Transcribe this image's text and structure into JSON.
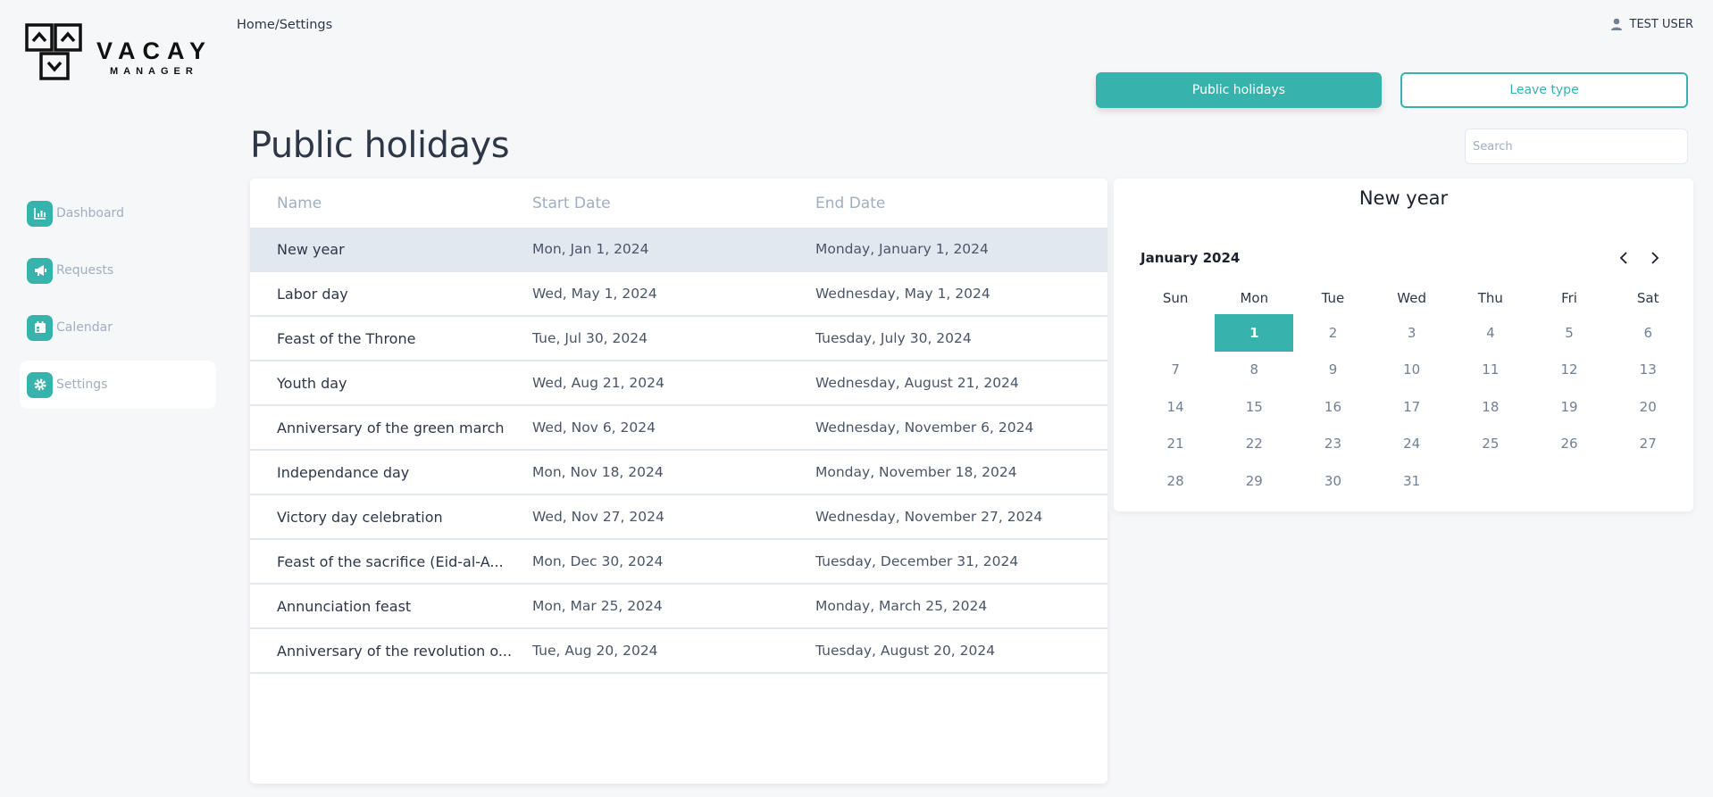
{
  "app": {
    "logo_word": "VACAY",
    "logo_sub": "MANAGER",
    "accent": "#38b2ac"
  },
  "header": {
    "breadcrumb": "Home/Settings",
    "user_name": "TEST USER"
  },
  "sidebar": {
    "items": [
      {
        "label": "Dashboard",
        "icon": "chart-bar-icon"
      },
      {
        "label": "Requests",
        "icon": "megaphone-icon"
      },
      {
        "label": "Calendar",
        "icon": "calendar-icon"
      },
      {
        "label": "Settings",
        "icon": "gear-icon",
        "active": true
      }
    ]
  },
  "tabs": {
    "public_holidays": "Public holidays",
    "leave_type": "Leave type"
  },
  "page": {
    "title": "Public holidays",
    "search_placeholder": "Search"
  },
  "table": {
    "columns": [
      "Name",
      "Start Date",
      "End Date"
    ],
    "rows": [
      {
        "name": "New year",
        "start": "Mon, Jan 1, 2024",
        "end": "Monday, January 1, 2024",
        "selected": true
      },
      {
        "name": "Labor day",
        "start": "Wed, May 1, 2024",
        "end": "Wednesday, May 1, 2024"
      },
      {
        "name": "Feast of the Throne",
        "start": "Tue, Jul 30, 2024",
        "end": "Tuesday, July 30, 2024"
      },
      {
        "name": "Youth day",
        "start": "Wed, Aug 21, 2024",
        "end": "Wednesday, August 21, 2024"
      },
      {
        "name": "Anniversary of the green march",
        "start": "Wed, Nov 6, 2024",
        "end": "Wednesday, November 6, 2024"
      },
      {
        "name": "Independance day",
        "start": "Mon, Nov 18, 2024",
        "end": "Monday, November 18, 2024"
      },
      {
        "name": "Victory day celebration",
        "start": "Wed, Nov 27, 2024",
        "end": "Wednesday, November 27, 2024"
      },
      {
        "name": "Feast of the sacrifice (Eid-al-A...",
        "start": "Mon, Dec 30, 2024",
        "end": "Tuesday, December 31, 2024"
      },
      {
        "name": "Annunciation feast",
        "start": "Mon, Mar 25, 2024",
        "end": "Monday, March 25, 2024"
      },
      {
        "name": "Anniversary of the revolution o...",
        "start": "Tue, Aug 20, 2024",
        "end": "Tuesday, August 20, 2024"
      }
    ]
  },
  "calendar": {
    "title": "New year",
    "month_label": "January 2024",
    "weekdays": [
      "Sun",
      "Mon",
      "Tue",
      "Wed",
      "Thu",
      "Fri",
      "Sat"
    ],
    "weeks": [
      [
        "",
        "1",
        "2",
        "3",
        "4",
        "5",
        "6"
      ],
      [
        "7",
        "8",
        "9",
        "10",
        "11",
        "12",
        "13"
      ],
      [
        "14",
        "15",
        "16",
        "17",
        "18",
        "19",
        "20"
      ],
      [
        "21",
        "22",
        "23",
        "24",
        "25",
        "26",
        "27"
      ],
      [
        "28",
        "29",
        "30",
        "31",
        "",
        "",
        ""
      ]
    ],
    "selected_day": "1"
  }
}
